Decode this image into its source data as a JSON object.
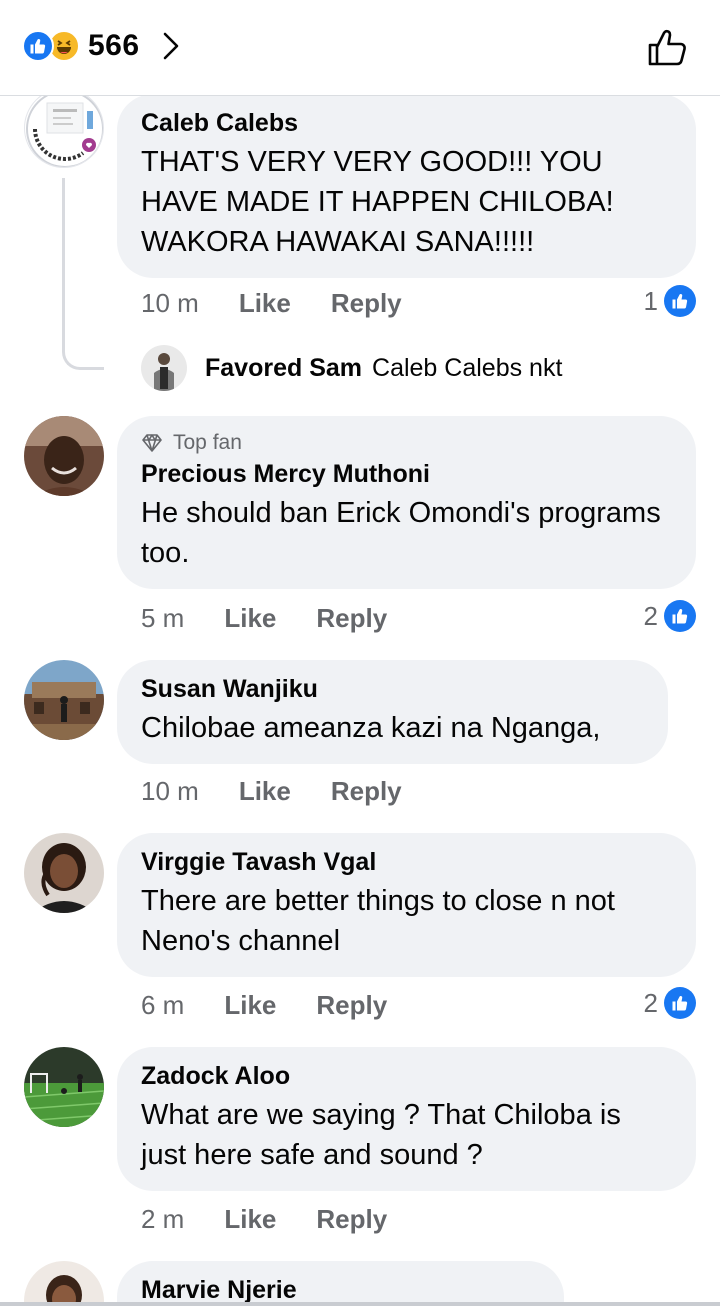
{
  "header": {
    "reaction_count": "566",
    "reaction_icons": [
      "like-icon",
      "haha-icon"
    ],
    "like_button_icon": "thumbs-up-outline-icon"
  },
  "comments": [
    {
      "author": "Caleb Calebs",
      "text": "THAT'S VERY VERY GOOD!!! YOU HAVE MADE IT HAPPEN CHILOBA! WAKORA HAWAKAI SANA!!!!!",
      "time": "10 m",
      "like": "Like",
      "reply": "Reply",
      "reactions": "1",
      "reply_preview": {
        "author": "Favored Sam",
        "text": "Caleb Calebs nkt"
      }
    },
    {
      "badge": "Top fan",
      "author": "Precious Mercy Muthoni",
      "text": "He should ban Erick Omondi's programs too.",
      "time": "5 m",
      "like": "Like",
      "reply": "Reply",
      "reactions": "2"
    },
    {
      "author": "Susan Wanjiku",
      "text": "Chilobae ameanza kazi na Nganga,",
      "time": "10 m",
      "like": "Like",
      "reply": "Reply"
    },
    {
      "author": "Virggie Tavash Vgal",
      "text": "There are better things to close n not Neno's channel",
      "time": "6 m",
      "like": "Like",
      "reply": "Reply",
      "reactions": "2"
    },
    {
      "author": "Zadock Aloo",
      "text": "What are we saying ? That Chiloba is just here safe and sound ?",
      "time": "2 m",
      "like": "Like",
      "reply": "Reply"
    },
    {
      "author": "Marvie Njerie"
    }
  ],
  "colors": {
    "accent": "#1877f2",
    "bubble": "#f0f2f5",
    "muted": "#65676b"
  }
}
